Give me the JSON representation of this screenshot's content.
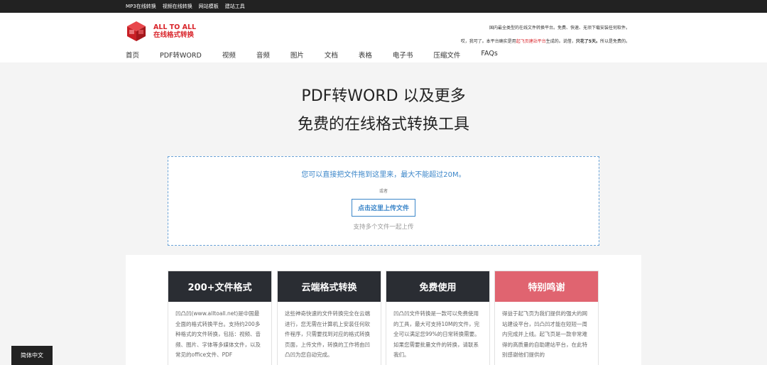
{
  "topbar": {
    "links": [
      "MP3在线转换",
      "视频在线转换",
      "网站模板",
      "建站工具"
    ]
  },
  "logo": {
    "line1": "ALL TO ALL",
    "line2": "在线格式转换"
  },
  "notice": {
    "line1": "国内最全类型的在线文件转换平台。免费、快速、无须下载安装任何软件。",
    "line2_pre": "哎，我可了。本平台确实是用",
    "line2_hl": "起飞页建站平台",
    "line2_mid": "生成的。说借，",
    "line2_bold": "只花了5天。",
    "line2_post": "所以是免费的。"
  },
  "nav": {
    "items": [
      "首页",
      "PDF转WORD",
      "视频",
      "音频",
      "图片",
      "文档",
      "表格",
      "电子书",
      "压缩文件",
      "FAQs"
    ]
  },
  "hero": {
    "title1": "PDF转WORD 以及更多",
    "title2": "免费的在线格式转换工具"
  },
  "upload": {
    "drop_text": "您可以直接把文件拖到这里来，最大不能超过20M。",
    "or_text": "或者",
    "button_label": "点击这里上传文件",
    "multi_text": "支持多个文件一起上传"
  },
  "features": [
    {
      "title": "200+文件格式",
      "body": "凹凸凹(www.alltoall.net)是中国最全面的格式转换平台。支持约200多种格式的文件转换，包括：视频、音频、图片、字体等多媒体文件，以及常见的office文件、PDF"
    },
    {
      "title": "云端格式转换",
      "body": "这些神奇快速的文件转换完全在云端进行，您无需在计算机上安装任何软件程序，只需要找到对应的格式转换页面，上传文件，转换的工作将由凹凸凹为您自动完成。"
    },
    {
      "title": "免费使用",
      "body": "凹凸凹文件转换是一款可以免费使用的工具，最大可支持10M的文件，完全可以满足您99%的日常转换需要。如果您需要批量文件的转换，请联系我们。"
    },
    {
      "title": "特别鸣谢",
      "body": "得益于起飞页为我们提供的强大的网站建设平台，凹凸凹才能在短短一周内完成并上线。起飞页是一款非常难得的高质量的自助建站平台，在此特别感谢他们提供的"
    }
  ],
  "language_button": "简体中文",
  "colors": {
    "brand_red": "#d9262c",
    "accent_blue": "#3b86c9",
    "dark": "#2a2d33",
    "pink": "#e06470"
  }
}
